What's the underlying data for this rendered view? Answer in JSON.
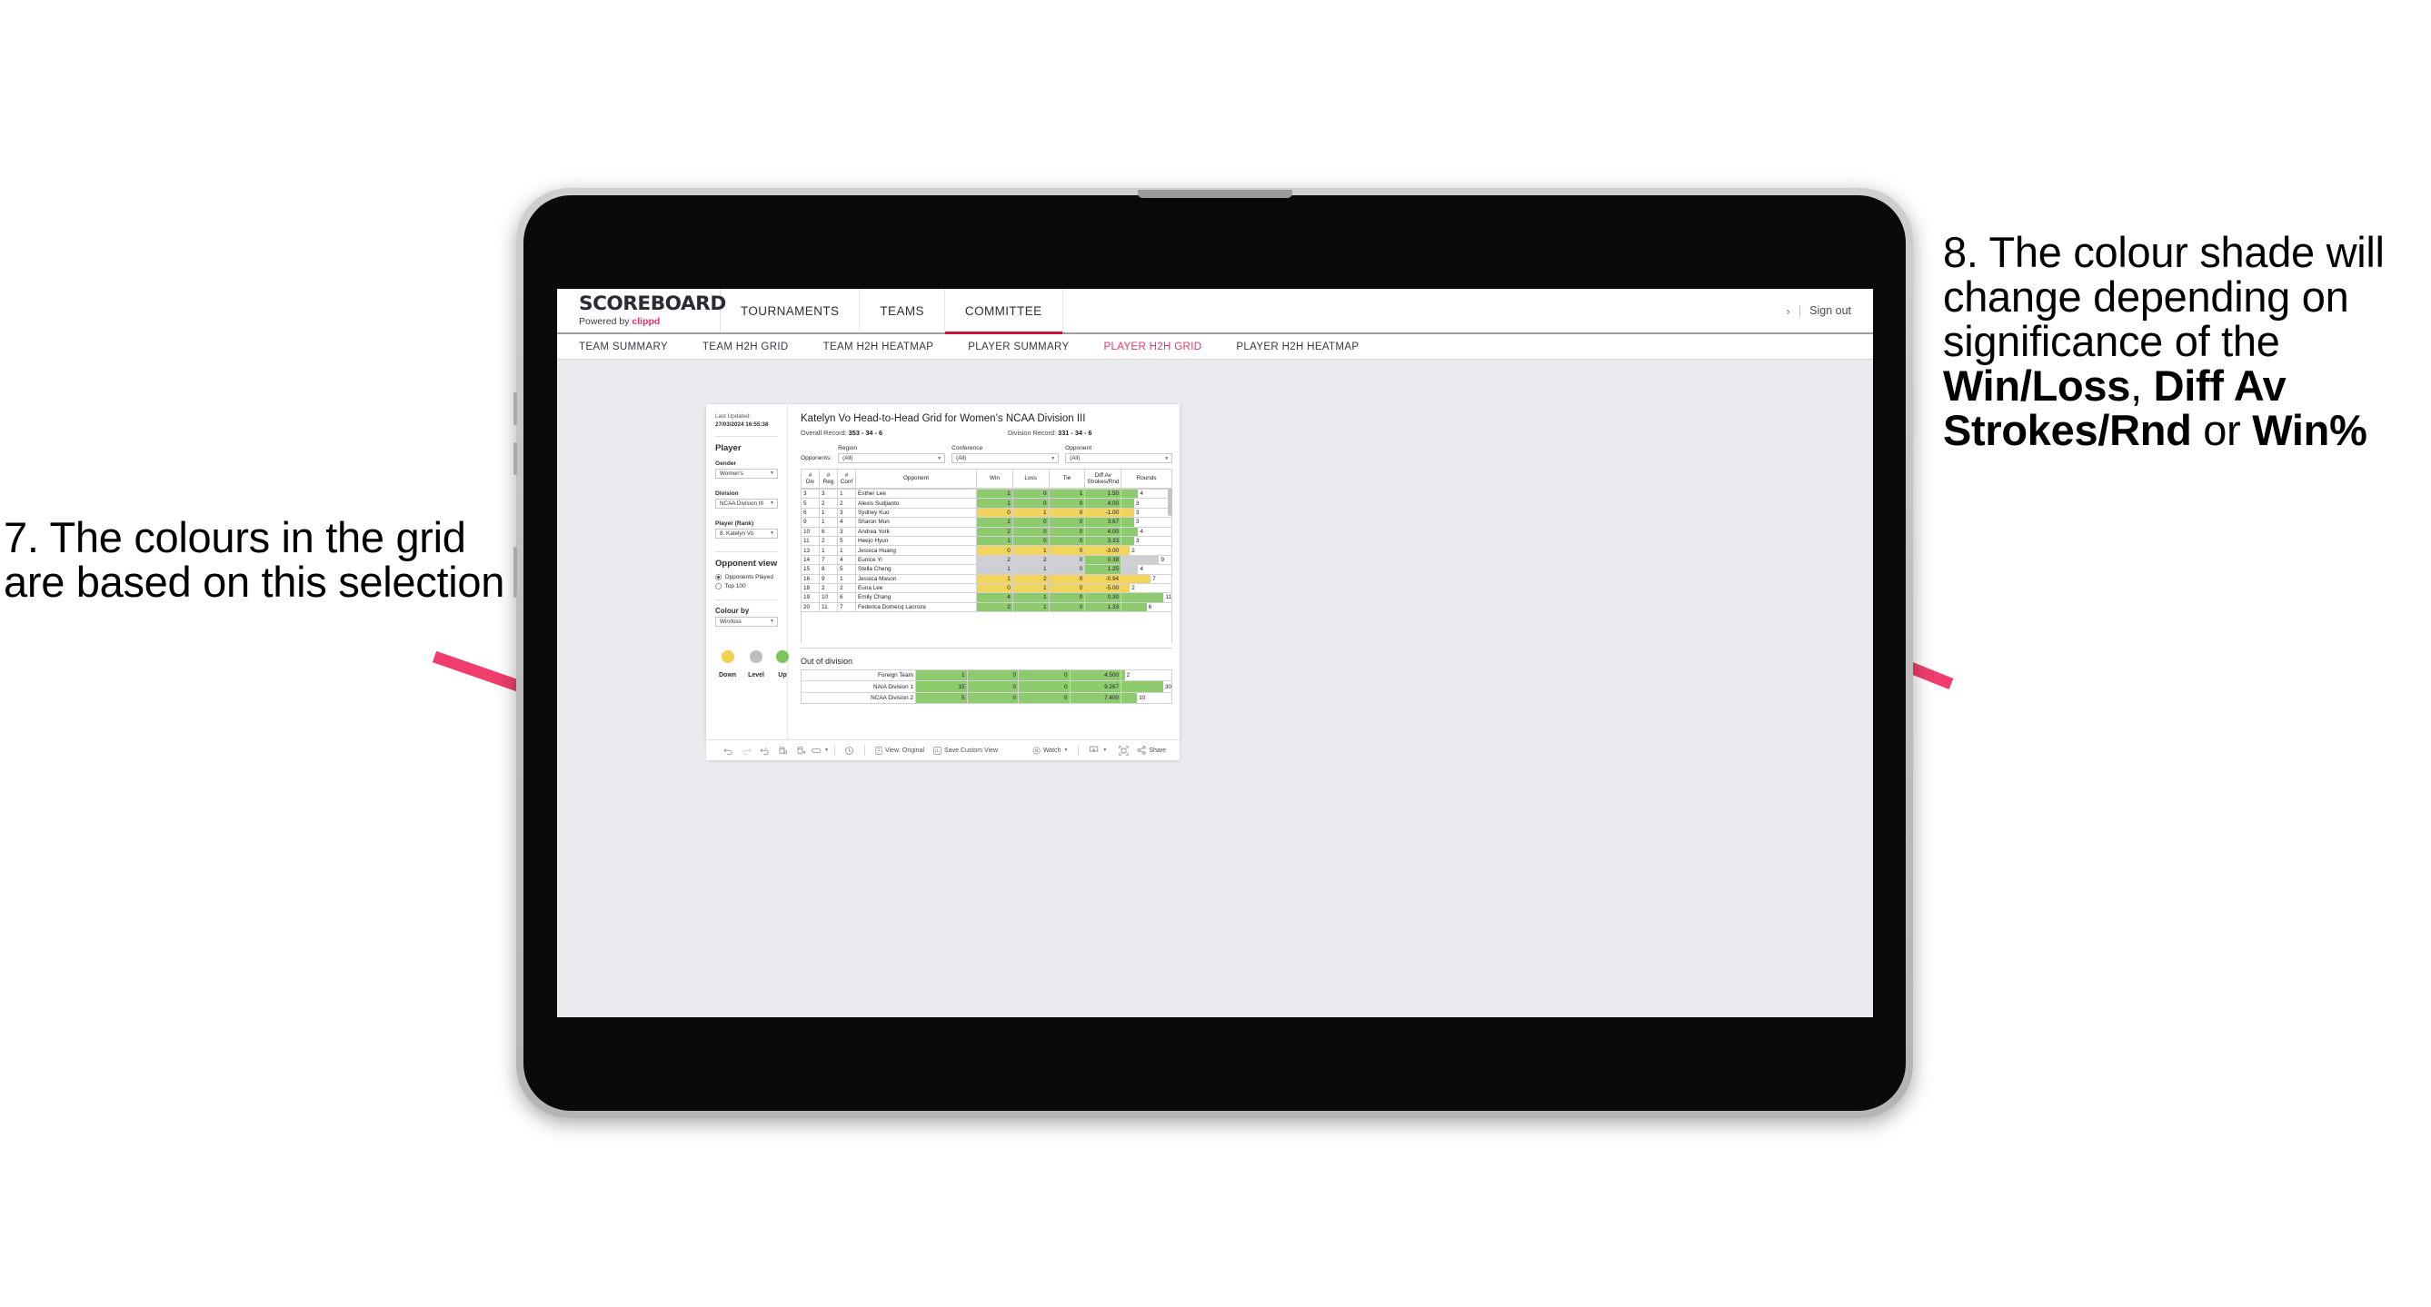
{
  "annotations": {
    "left": {
      "id": "7",
      "text": "7. The colours in the grid are based on this selection"
    },
    "right": {
      "id": "8",
      "part1": "8. The colour shade will change depending on significance of the ",
      "bold1": "Win/Loss",
      "mid1": ", ",
      "bold2": "Diff Av Strokes/Rnd",
      "mid2": " or ",
      "bold3": "Win%"
    },
    "arrow_color": "#ef3e6d"
  },
  "topnav": {
    "brand_title": "SCOREBOARD",
    "brand_sub_prefix": "Powered by ",
    "brand_sub_brand": "clippd",
    "tabs": [
      {
        "label": "TOURNAMENTS",
        "active": false
      },
      {
        "label": "TEAMS",
        "active": false
      },
      {
        "label": "COMMITTEE",
        "active": true
      }
    ],
    "chevron": "›",
    "divider": "|",
    "signout": "Sign out",
    "accent": "#c8123f"
  },
  "subnav": {
    "tabs": [
      {
        "label": "TEAM SUMMARY",
        "active": false
      },
      {
        "label": "TEAM H2H GRID",
        "active": false
      },
      {
        "label": "TEAM H2H HEATMAP",
        "active": false
      },
      {
        "label": "PLAYER SUMMARY",
        "active": false
      },
      {
        "label": "PLAYER H2H GRID",
        "active": true
      },
      {
        "label": "PLAYER H2H HEATMAP",
        "active": false
      }
    ],
    "active_color": "#e8336d"
  },
  "filters": {
    "last_updated_label": "Last Updated: ",
    "last_updated_value": "27/03/2024 16:55:38",
    "player_section": "Player",
    "gender_label": "Gender",
    "gender_value": "Women’s",
    "division_label": "Division",
    "division_value": "NCAA Division III",
    "player_rank_label": "Player (Rank)",
    "player_rank_value": "8. Katelyn Vo",
    "opponent_view_label": "Opponent view",
    "opponent_view_options": [
      {
        "label": "Opponents Played",
        "selected": true
      },
      {
        "label": "Top 100",
        "selected": false
      }
    ],
    "colour_by_label": "Colour by",
    "colour_by_value": "Win/loss",
    "legend": [
      {
        "label": "Down",
        "color": "#f2d14e"
      },
      {
        "label": "Level",
        "color": "#bcbcc1"
      },
      {
        "label": "Up",
        "color": "#7cc45c"
      }
    ]
  },
  "viz": {
    "title": "Katelyn Vo Head-to-Head Grid for Women’s NCAA Division III",
    "overall_record_label": "Overall Record: ",
    "overall_record_value": "353 -  34 - 6",
    "division_record_label": "Division Record: ",
    "division_record_value": "331 -  34 - 6",
    "opponents_label": "Opponents:",
    "opponent_filters": [
      {
        "label": "Region",
        "value": "(All)"
      },
      {
        "label": "Conference",
        "value": "(All)"
      },
      {
        "label": "Opponent",
        "value": "(All)"
      }
    ],
    "out_of_division_title": "Out of division"
  },
  "chart_data": {
    "type": "table",
    "title": "Katelyn Vo Head-to-Head Grid for Women’s NCAA Division III",
    "columns": [
      "# Div",
      "# Reg",
      "# Conf",
      "Opponent",
      "Win",
      "Loss",
      "Tie",
      "Diff Av Strokes/Rnd",
      "Rounds"
    ],
    "column_headers_twoline": [
      {
        "l1": "#",
        "l2": "Div"
      },
      {
        "l1": "#",
        "l2": "Reg"
      },
      {
        "l1": "#",
        "l2": "Conf"
      },
      {
        "l1": "Opponent",
        "l2": ""
      },
      {
        "l1": "Win",
        "l2": ""
      },
      {
        "l1": "Loss",
        "l2": ""
      },
      {
        "l1": "Tie",
        "l2": ""
      },
      {
        "l1": "Diff Av",
        "l2": "Strokes/Rnd"
      },
      {
        "l1": "Rounds",
        "l2": ""
      }
    ],
    "rounds_max": 12,
    "rows": [
      {
        "div": "3",
        "reg": "3",
        "conf": "1",
        "opponent": "Esther Lee",
        "win": "1",
        "loss": "0",
        "tie": "1",
        "diff": "1.50",
        "rounds": "4",
        "rounds_num": 4,
        "shade": "up"
      },
      {
        "div": "5",
        "reg": "2",
        "conf": "2",
        "opponent": "Alexis Sudjianto",
        "win": "1",
        "loss": "0",
        "tie": "0",
        "diff": "4.00",
        "rounds": "3",
        "rounds_num": 3,
        "shade": "up"
      },
      {
        "div": "6",
        "reg": "1",
        "conf": "3",
        "opponent": "Sydney Kuo",
        "win": "0",
        "loss": "1",
        "tie": "0",
        "diff": "-1.00",
        "rounds": "3",
        "rounds_num": 3,
        "shade": "down"
      },
      {
        "div": "9",
        "reg": "1",
        "conf": "4",
        "opponent": "Sharon Mun",
        "win": "1",
        "loss": "0",
        "tie": "0",
        "diff": "3.67",
        "rounds": "3",
        "rounds_num": 3,
        "shade": "up"
      },
      {
        "div": "10",
        "reg": "6",
        "conf": "3",
        "opponent": "Andrea York",
        "win": "2",
        "loss": "0",
        "tie": "0",
        "diff": "4.00",
        "rounds": "4",
        "rounds_num": 4,
        "shade": "up"
      },
      {
        "div": "11",
        "reg": "2",
        "conf": "5",
        "opponent": "Heejo Hyun",
        "win": "1",
        "loss": "0",
        "tie": "0",
        "diff": "3.33",
        "rounds": "3",
        "rounds_num": 3,
        "shade": "up"
      },
      {
        "div": "13",
        "reg": "1",
        "conf": "1",
        "opponent": "Jessica Huang",
        "win": "0",
        "loss": "1",
        "tie": "0",
        "diff": "-3.00",
        "rounds": "2",
        "rounds_num": 2,
        "shade": "down"
      },
      {
        "div": "14",
        "reg": "7",
        "conf": "4",
        "opponent": "Eunice Yi",
        "win": "2",
        "loss": "2",
        "tie": "0",
        "diff": "0.38",
        "rounds": "9",
        "rounds_num": 9,
        "shade": "level",
        "diff_shade": "up"
      },
      {
        "div": "15",
        "reg": "8",
        "conf": "5",
        "opponent": "Stella Cheng",
        "win": "1",
        "loss": "1",
        "tie": "0",
        "diff": "1.25",
        "rounds": "4",
        "rounds_num": 4,
        "shade": "level",
        "diff_shade": "up"
      },
      {
        "div": "16",
        "reg": "9",
        "conf": "1",
        "opponent": "Jessica Mason",
        "win": "1",
        "loss": "2",
        "tie": "0",
        "diff": "-0.94",
        "rounds": "7",
        "rounds_num": 7,
        "shade": "down"
      },
      {
        "div": "18",
        "reg": "2",
        "conf": "2",
        "opponent": "Euna Lee",
        "win": "0",
        "loss": "1",
        "tie": "0",
        "diff": "-5.00",
        "rounds": "2",
        "rounds_num": 2,
        "shade": "down"
      },
      {
        "div": "19",
        "reg": "10",
        "conf": "6",
        "opponent": "Emily Chang",
        "win": "4",
        "loss": "1",
        "tie": "0",
        "diff": "0.30",
        "rounds": "11",
        "rounds_num": 11,
        "shade": "up"
      },
      {
        "div": "20",
        "reg": "11",
        "conf": "7",
        "opponent": "Federica Domecq Lacroze",
        "win": "2",
        "loss": "1",
        "tie": "0",
        "diff": "1.33",
        "rounds": "6",
        "rounds_num": 6,
        "shade": "up"
      }
    ],
    "out_of_division": {
      "title": "Out of division",
      "rounds_max": 32,
      "rows": [
        {
          "name": "Foreign Team",
          "win": "1",
          "loss": "0",
          "tie": "0",
          "diff": "4.500",
          "rounds": "2",
          "rounds_num": 2,
          "shade": "up"
        },
        {
          "name": "NAIA Division 1",
          "win": "15",
          "loss": "0",
          "tie": "0",
          "diff": "9.267",
          "rounds": "30",
          "rounds_num": 30,
          "shade": "up"
        },
        {
          "name": "NCAA Division 2",
          "win": "5",
          "loss": "0",
          "tie": "0",
          "diff": "7.400",
          "rounds": "10",
          "rounds_num": 10,
          "shade": "up"
        }
      ]
    },
    "colors": {
      "up": "#8ecb6e",
      "down": "#f2d35c",
      "level": "#cfcfd3",
      "neutral": "#ffffff"
    }
  },
  "toolbar": {
    "icons": [
      "undo-icon",
      "redo-icon",
      "revert-icon",
      "refresh-data-icon",
      "pause-updates-icon",
      "presentation-mode-icon"
    ],
    "view_label": "View: Original",
    "save_label": "Save Custom View",
    "watch_label": "Watch",
    "share_label": "Share",
    "download_label": "download-icon",
    "fullscreen_label": "fullscreen-icon"
  }
}
